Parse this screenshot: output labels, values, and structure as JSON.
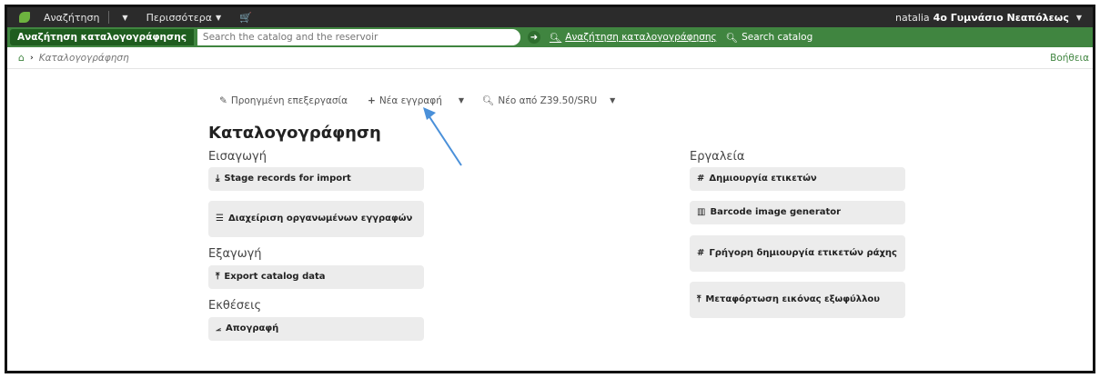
{
  "topbar": {
    "search_label": "Αναζήτηση",
    "more_label": "Περισσότερα",
    "cart_icon": "cart-icon",
    "user_name": "natalia",
    "library": "4ο Γυμνάσιο Νεαπόλεως"
  },
  "searchbar": {
    "label": "Αναζήτηση καταλογογράφησης",
    "placeholder": "Search the catalog and the reservoir",
    "value": "",
    "tab_cataloging": "Αναζήτηση καταλογογράφησης",
    "tab_catalog": "Search catalog"
  },
  "breadcrumb": {
    "current": "Καταλογογράφηση",
    "help": "Βοήθεια"
  },
  "toolbar": {
    "advanced_edit": "Προηγμένη επεξεργασία",
    "new_record": "Νέα εγγραφή",
    "new_z3950": "Νέο από Z39.50/SRU"
  },
  "page": {
    "title": "Καταλογογράφηση"
  },
  "sections": {
    "import": {
      "title": "Εισαγωγή",
      "stage": "Stage records for import",
      "manage": "Διαχείριση οργανωμένων εγγραφών"
    },
    "export": {
      "title": "Εξαγωγή",
      "export_data": "Export catalog data"
    },
    "reports": {
      "title": "Εκθέσεις",
      "inventory": "Απογραφή"
    },
    "tools": {
      "title": "Εργαλεία",
      "labels": "Δημιουργία ετικετών",
      "barcode": "Barcode image generator",
      "spine": "Γρήγορη δημιουργία ετικετών ράχης",
      "cover": "Μεταφόρτωση εικόνας εξωφύλλου"
    }
  },
  "colors": {
    "topbar": "#2b2b2b",
    "searchbar": "#408540",
    "accent": "#408540",
    "tile": "#ececec",
    "annotation_arrow": "#4a90d9"
  }
}
